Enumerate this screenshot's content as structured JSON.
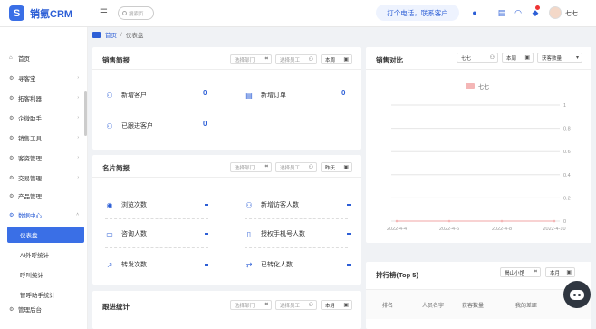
{
  "app": {
    "logo_text": "销氪CRM",
    "logo_mark": "S"
  },
  "header": {
    "search_placeholder": "搜索页",
    "call_button": "打个电话，联系客户",
    "user_name": "七七"
  },
  "sidebar": {
    "items": [
      {
        "label": "首页",
        "icon": "home-icon"
      },
      {
        "label": "寻客宝",
        "icon": "gear-icon"
      },
      {
        "label": "拓客利器",
        "icon": "gear-icon"
      },
      {
        "label": "企微助手",
        "icon": "gear-icon"
      },
      {
        "label": "销售工具",
        "icon": "gear-icon"
      },
      {
        "label": "客资管理",
        "icon": "gear-icon"
      },
      {
        "label": "交易管理",
        "icon": "gear-icon"
      },
      {
        "label": "产品管理",
        "icon": "gear-icon"
      },
      {
        "label": "数据中心",
        "icon": "gear-icon"
      }
    ],
    "subitems": [
      "仪表盘",
      "AI外呼统计",
      "呼叫统计",
      "智呼助手统计"
    ],
    "bottom_item": "管理后台"
  },
  "breadcrumb": {
    "home": "首页",
    "current": "仪表盘"
  },
  "sales_brief": {
    "title": "销售简报",
    "dept_placeholder": "选择部门",
    "staff_placeholder": "选择员工",
    "period": "本周",
    "stats": [
      {
        "label": "新增客户",
        "value": "0"
      },
      {
        "label": "新增订单",
        "value": "0"
      },
      {
        "label": "已跟进客户",
        "value": "0"
      }
    ]
  },
  "card_brief": {
    "title": "名片简报",
    "dept_placeholder": "选择部门",
    "staff_placeholder": "选择员工",
    "period": "昨天",
    "stats": [
      {
        "label": "浏览次数",
        "value": "-"
      },
      {
        "label": "新增访客人数",
        "value": "-"
      },
      {
        "label": "咨询人数",
        "value": "-"
      },
      {
        "label": "授权手机号人数",
        "value": "-"
      },
      {
        "label": "转发次数",
        "value": "-"
      },
      {
        "label": "已转化人数",
        "value": "-"
      }
    ]
  },
  "follow_stats": {
    "title": "跟进统计",
    "dept_placeholder": "选择部门",
    "staff_placeholder": "选择员工",
    "period": "本月"
  },
  "sales_compare": {
    "title": "销售对比",
    "person": "七七",
    "period": "本周",
    "metric": "获客数量"
  },
  "ranking": {
    "title": "排行榜(Top 5)",
    "scope": "揭山小馆",
    "period": "本月",
    "columns": [
      "排名",
      "人员名字",
      "获客数量",
      "我的差距"
    ]
  },
  "chart_data": {
    "type": "line",
    "x": [
      "2022-4-4",
      "2022-4-6",
      "2022-4-8",
      "2022-4-10"
    ],
    "series": [
      {
        "name": "七七",
        "values": [
          0,
          0,
          0,
          0
        ],
        "color": "#f4b6b6"
      }
    ],
    "ylim": [
      0,
      1
    ],
    "yticks": [
      "0",
      "0.2",
      "0.4",
      "0.6",
      "0.8",
      "1"
    ],
    "legend": "top-center",
    "grid": true
  }
}
